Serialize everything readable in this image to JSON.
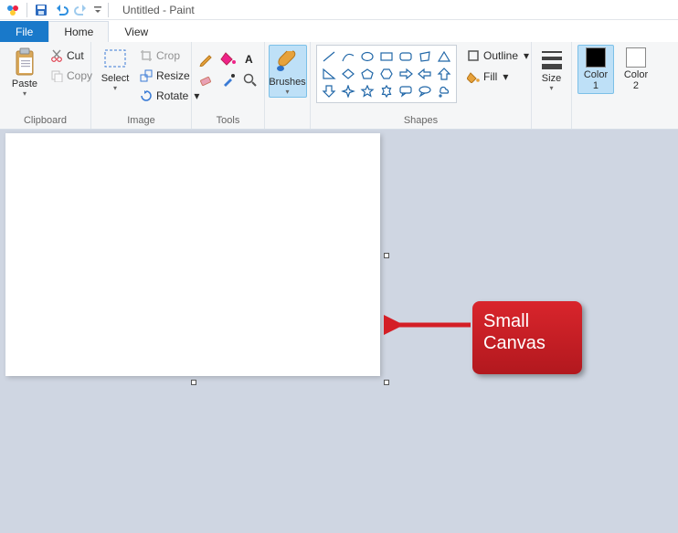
{
  "title": "Untitled - Paint",
  "tabs": {
    "file": "File",
    "home": "Home",
    "view": "View"
  },
  "clipboard": {
    "group": "Clipboard",
    "paste": "Paste",
    "cut": "Cut",
    "copy": "Copy"
  },
  "image": {
    "group": "Image",
    "select": "Select",
    "crop": "Crop",
    "resize": "Resize",
    "rotate": "Rotate"
  },
  "tools": {
    "group": "Tools"
  },
  "brushes": {
    "group": "",
    "label": "Brushes"
  },
  "shapes": {
    "group": "Shapes",
    "outline": "Outline",
    "fill": "Fill"
  },
  "size": {
    "group": "",
    "label": "Size"
  },
  "colors": {
    "color1": "Color\n1",
    "color2": "Color\n2"
  },
  "annotation": {
    "line1": "Small",
    "line2": "Canvas"
  }
}
